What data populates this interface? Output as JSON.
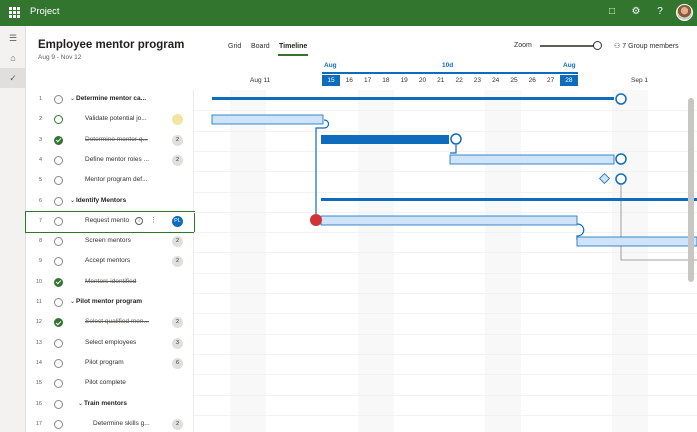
{
  "app": {
    "name": "Project"
  },
  "topbar": {
    "icons": [
      "bell-icon",
      "gear-icon",
      "help-icon"
    ],
    "glyphs": [
      "□",
      "⚙",
      "?"
    ]
  },
  "rail": {
    "glyphs": [
      "☰",
      "⌂",
      "✓"
    ]
  },
  "project": {
    "title": "Employee mentor program",
    "dates": "Aug 9 - Nov 12"
  },
  "views": [
    {
      "label": "Grid",
      "active": false
    },
    {
      "label": "Board",
      "active": false
    },
    {
      "label": "Timeline",
      "active": true
    }
  ],
  "zoom": {
    "label": "Zoom",
    "level": 0.92
  },
  "members": {
    "label": "7 Group members"
  },
  "tasks": [
    {
      "num": "1",
      "name": "Determine mentor ca...",
      "summary": true,
      "done": false,
      "strike": false,
      "indent": 0,
      "badge": ""
    },
    {
      "num": "2",
      "name": "Validate potential jo...",
      "summary": false,
      "done": false,
      "strike": false,
      "indent": 1,
      "badge": "",
      "badgeType": "person",
      "hoverCheck": true
    },
    {
      "num": "3",
      "name": "Determine mentor q...",
      "summary": false,
      "done": true,
      "strike": true,
      "indent": 1,
      "badge": "2"
    },
    {
      "num": "4",
      "name": "Define mentor roles ...",
      "summary": false,
      "done": false,
      "strike": false,
      "indent": 1,
      "badge": "2"
    },
    {
      "num": "5",
      "name": "Mentor program def...",
      "summary": false,
      "done": false,
      "strike": false,
      "indent": 1,
      "badge": ""
    },
    {
      "num": "6",
      "name": "Identify Mentors",
      "summary": true,
      "done": false,
      "strike": false,
      "indent": 0,
      "badge": ""
    },
    {
      "num": "7",
      "name": "Request mento",
      "summary": false,
      "done": false,
      "strike": false,
      "indent": 1,
      "badge": "PL",
      "badgeType": "blue",
      "selected": true
    },
    {
      "num": "8",
      "name": "Screen mentors",
      "summary": false,
      "done": false,
      "strike": false,
      "indent": 1,
      "badge": "2"
    },
    {
      "num": "9",
      "name": "Accept mentors",
      "summary": false,
      "done": false,
      "strike": false,
      "indent": 1,
      "badge": "2"
    },
    {
      "num": "10",
      "name": "Mentors identified",
      "summary": false,
      "done": true,
      "strike": true,
      "indent": 1,
      "badge": ""
    },
    {
      "num": "11",
      "name": "Pilot mentor program",
      "summary": true,
      "done": false,
      "strike": false,
      "indent": 0,
      "badge": ""
    },
    {
      "num": "12",
      "name": "Select qualified men...",
      "summary": false,
      "done": true,
      "strike": true,
      "indent": 1,
      "badge": "2"
    },
    {
      "num": "13",
      "name": "Select employees",
      "summary": false,
      "done": false,
      "strike": false,
      "indent": 1,
      "badge": "3"
    },
    {
      "num": "14",
      "name": "Pilot program",
      "summary": false,
      "done": false,
      "strike": false,
      "indent": 1,
      "badge": "6"
    },
    {
      "num": "15",
      "name": "Pilot complete",
      "summary": false,
      "done": false,
      "strike": false,
      "indent": 1,
      "badge": ""
    },
    {
      "num": "16",
      "name": "Train mentors",
      "summary": true,
      "done": false,
      "strike": false,
      "indent": 1,
      "badge": ""
    },
    {
      "num": "17",
      "name": "Determine skills g...",
      "summary": false,
      "done": false,
      "strike": false,
      "indent": 2,
      "badge": "2"
    }
  ],
  "timeline": {
    "aug11_label": "Aug 11",
    "sep1_label": "Sep 1",
    "month_left": "Aug",
    "month_right": "Aug",
    "duration_label": "10d",
    "days": [
      "15",
      "16",
      "17",
      "18",
      "19",
      "20",
      "21",
      "22",
      "23",
      "24",
      "25",
      "26",
      "27",
      "28"
    ],
    "highlight_start": "15",
    "highlight_end": "28",
    "accent": "#0f6cbd",
    "bar_fill": "#cfe4fa",
    "done_fill": "#0f6cbd",
    "warning": "#d13438"
  }
}
